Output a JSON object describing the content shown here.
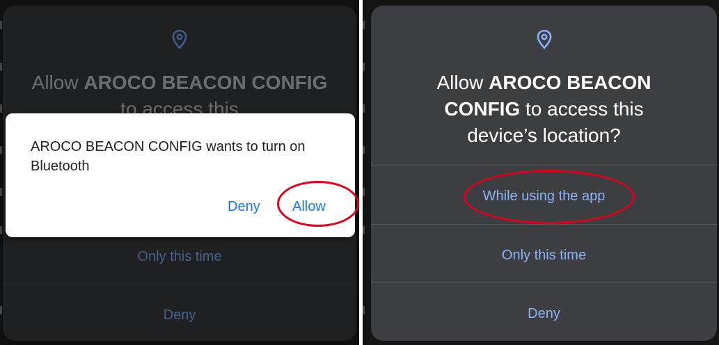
{
  "left_screen": {
    "permission": {
      "icon": "location-pin-icon",
      "title_prefix": "Allow ",
      "title_app": "AROCO BEACON CONFIG",
      "title_suffix": " to access this",
      "option_2": "Only this time",
      "option_3": "Deny"
    },
    "bluetooth_dialog": {
      "message": "AROCO BEACON CONFIG wants to turn on Bluetooth",
      "deny_label": "Deny",
      "allow_label": "Allow"
    }
  },
  "right_screen": {
    "permission": {
      "icon": "location-pin-icon",
      "title_prefix": "Allow ",
      "title_app_line1": "AROCO BEACON",
      "title_app_line2": "CONFIG",
      "title_suffix_line2": " to access this",
      "title_line3": "device’s location?",
      "option_1": "While using the app",
      "option_2": "Only this time",
      "option_3": "Deny"
    }
  },
  "colors": {
    "accent_blue": "#1a73e8",
    "option_blue": "#8ab4f8",
    "highlight_red": "#e0001b"
  }
}
